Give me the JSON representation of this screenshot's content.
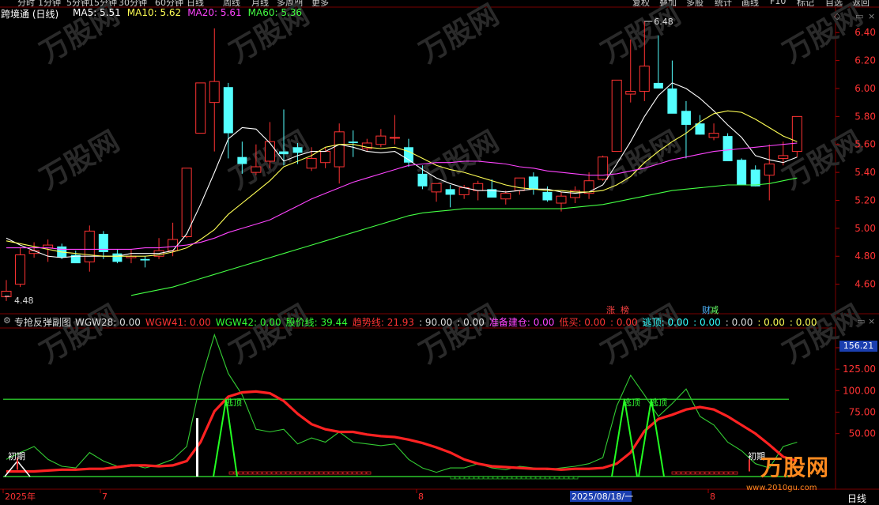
{
  "menu": {
    "left": [
      "分时",
      "1分钟",
      "5分钟",
      "15分钟",
      "30分钟",
      "60分钟",
      "日线",
      "周线",
      "月线",
      "多周期",
      "更多"
    ],
    "right": [
      "复权",
      "叠加",
      "多股",
      "统计",
      "画线",
      "F10",
      "标记",
      "自选",
      "返回"
    ]
  },
  "main_panel": {
    "title": "跨境通 (日线)",
    "ma_labels": [
      {
        "name": "MA5",
        "value": "5.51",
        "color": "#ffffff"
      },
      {
        "name": "MA10",
        "value": "5.62",
        "color": "#ffff55"
      },
      {
        "name": "MA20",
        "value": "5.61",
        "color": "#ff44ff"
      },
      {
        "name": "MA60",
        "value": "5.36",
        "color": "#44ff44"
      }
    ],
    "high_label": "6.48",
    "low_label": "4.48",
    "event_tags": [
      {
        "text": "涨",
        "color": "#ff4444"
      },
      {
        "text": "榜",
        "color": "#ff4444"
      },
      {
        "text": "财",
        "color": "#4fb6ff"
      },
      {
        "text": "减",
        "color": "#66ff66"
      }
    ]
  },
  "sub_panel": {
    "title": "专抢反弹副图",
    "items": [
      {
        "text": "WGW28: 0.00",
        "color": "#dddddd"
      },
      {
        "text": "WGW41: 0.00",
        "color": "#ff3333"
      },
      {
        "text": "WGW42: 0.00",
        "color": "#33ff33"
      },
      {
        "text": "股价线: 39.44",
        "color": "#33ff33"
      },
      {
        "text": "趋势线: 21.93",
        "color": "#ff3333"
      },
      {
        "text": ": 90.00",
        "color": "#dddddd"
      },
      {
        "text": ": 0.00",
        "color": "#dddddd"
      },
      {
        "text": "准备建仓: 0.00",
        "color": "#ff44ff"
      },
      {
        "text": "低买: 0.00",
        "color": "#ff3333"
      },
      {
        "text": ": 0.00",
        "color": "#ff3333"
      },
      {
        "text": "逃顶: 0.00",
        "color": "#33ffff"
      },
      {
        "text": ": 0.00",
        "color": "#33ffff"
      },
      {
        "text": ": 0.00",
        "color": "#dddddd"
      },
      {
        "text": ": 0.00",
        "color": "#ffff55"
      },
      {
        "text": ": 0.00",
        "color": "#ffff55"
      }
    ],
    "current_value": "156.21",
    "annotations": {
      "initial": "初期",
      "escape_top": "逃顶"
    }
  },
  "date_axis": {
    "labels": [
      "2025年",
      "7",
      "8",
      "2025/08/18/一",
      "8"
    ],
    "period": "日线"
  },
  "watermark": {
    "brand": "万股网",
    "url": "www.2010gu.com"
  },
  "chart_data": [
    {
      "type": "candlestick",
      "title": "跨境通 (日线)",
      "ylim": [
        4.4,
        6.52
      ],
      "y_ticks": [
        4.6,
        4.8,
        5.0,
        5.2,
        5.4,
        5.6,
        5.8,
        6.0,
        6.2,
        6.4
      ],
      "candles": [
        {
          "o": 4.51,
          "h": 4.63,
          "l": 4.48,
          "c": 4.55
        },
        {
          "o": 4.6,
          "h": 4.86,
          "l": 4.58,
          "c": 4.81
        },
        {
          "o": 4.82,
          "h": 4.9,
          "l": 4.79,
          "c": 4.84
        },
        {
          "o": 4.86,
          "h": 4.92,
          "l": 4.76,
          "c": 4.88
        },
        {
          "o": 4.87,
          "h": 4.89,
          "l": 4.78,
          "c": 4.79
        },
        {
          "o": 4.81,
          "h": 4.84,
          "l": 4.76,
          "c": 4.75
        },
        {
          "o": 4.76,
          "h": 5.02,
          "l": 4.69,
          "c": 4.98
        },
        {
          "o": 4.96,
          "h": 4.98,
          "l": 4.78,
          "c": 4.83
        },
        {
          "o": 4.82,
          "h": 4.85,
          "l": 4.75,
          "c": 4.76
        },
        {
          "o": 4.79,
          "h": 4.85,
          "l": 4.75,
          "c": 4.8
        },
        {
          "o": 4.78,
          "h": 4.8,
          "l": 4.72,
          "c": 4.77
        },
        {
          "o": 4.8,
          "h": 4.93,
          "l": 4.78,
          "c": 4.84
        },
        {
          "o": 4.84,
          "h": 5.04,
          "l": 4.8,
          "c": 4.92
        },
        {
          "o": 4.94,
          "h": 5.43,
          "l": 4.93,
          "c": 5.43
        },
        {
          "o": 5.68,
          "h": 6.04,
          "l": 5.68,
          "c": 6.04
        },
        {
          "o": 5.9,
          "h": 6.43,
          "l": 5.55,
          "c": 6.05
        },
        {
          "o": 6.01,
          "h": 6.04,
          "l": 5.5,
          "c": 5.68
        },
        {
          "o": 5.51,
          "h": 5.62,
          "l": 5.39,
          "c": 5.46
        },
        {
          "o": 5.4,
          "h": 5.6,
          "l": 5.38,
          "c": 5.44
        },
        {
          "o": 5.48,
          "h": 5.76,
          "l": 5.43,
          "c": 5.62
        },
        {
          "o": 5.55,
          "h": 5.85,
          "l": 5.45,
          "c": 5.53
        },
        {
          "o": 5.58,
          "h": 5.61,
          "l": 5.46,
          "c": 5.54
        },
        {
          "o": 5.43,
          "h": 5.58,
          "l": 5.41,
          "c": 5.5
        },
        {
          "o": 5.47,
          "h": 5.58,
          "l": 5.43,
          "c": 5.55
        },
        {
          "o": 5.44,
          "h": 5.75,
          "l": 5.32,
          "c": 5.69
        },
        {
          "o": 5.62,
          "h": 5.7,
          "l": 5.51,
          "c": 5.61
        },
        {
          "o": 5.57,
          "h": 5.64,
          "l": 5.55,
          "c": 5.61
        },
        {
          "o": 5.6,
          "h": 5.71,
          "l": 5.58,
          "c": 5.66
        },
        {
          "o": 5.65,
          "h": 5.81,
          "l": 5.6,
          "c": 5.65
        },
        {
          "o": 5.58,
          "h": 5.64,
          "l": 5.44,
          "c": 5.47
        },
        {
          "o": 5.39,
          "h": 5.45,
          "l": 5.28,
          "c": 5.3
        },
        {
          "o": 5.26,
          "h": 5.32,
          "l": 5.19,
          "c": 5.32
        },
        {
          "o": 5.28,
          "h": 5.31,
          "l": 5.15,
          "c": 5.24
        },
        {
          "o": 5.24,
          "h": 5.31,
          "l": 5.21,
          "c": 5.29
        },
        {
          "o": 5.27,
          "h": 5.34,
          "l": 5.2,
          "c": 5.32
        },
        {
          "o": 5.28,
          "h": 5.35,
          "l": 5.23,
          "c": 5.22
        },
        {
          "o": 5.21,
          "h": 5.27,
          "l": 5.17,
          "c": 5.25
        },
        {
          "o": 5.27,
          "h": 5.35,
          "l": 5.24,
          "c": 5.36
        },
        {
          "o": 5.37,
          "h": 5.4,
          "l": 5.24,
          "c": 5.28
        },
        {
          "o": 5.26,
          "h": 5.3,
          "l": 5.19,
          "c": 5.2
        },
        {
          "o": 5.18,
          "h": 5.26,
          "l": 5.12,
          "c": 5.23
        },
        {
          "o": 5.22,
          "h": 5.3,
          "l": 5.18,
          "c": 5.27
        },
        {
          "o": 5.25,
          "h": 5.4,
          "l": 5.21,
          "c": 5.34
        },
        {
          "o": 5.35,
          "h": 5.52,
          "l": 5.34,
          "c": 5.51
        },
        {
          "o": 5.55,
          "h": 6.06,
          "l": 5.55,
          "c": 6.06
        },
        {
          "o": 5.96,
          "h": 6.35,
          "l": 5.9,
          "c": 5.98
        },
        {
          "o": 5.98,
          "h": 6.48,
          "l": 5.91,
          "c": 6.16
        },
        {
          "o": 6.04,
          "h": 6.38,
          "l": 6.0,
          "c": 6.0
        },
        {
          "o": 6.0,
          "h": 6.2,
          "l": 5.85,
          "c": 5.82
        },
        {
          "o": 5.84,
          "h": 5.91,
          "l": 5.5,
          "c": 5.74
        },
        {
          "o": 5.75,
          "h": 5.81,
          "l": 5.67,
          "c": 5.67
        },
        {
          "o": 5.65,
          "h": 5.75,
          "l": 5.63,
          "c": 5.68
        },
        {
          "o": 5.66,
          "h": 5.68,
          "l": 5.48,
          "c": 5.48
        },
        {
          "o": 5.49,
          "h": 5.5,
          "l": 5.31,
          "c": 5.31
        },
        {
          "o": 5.42,
          "h": 5.45,
          "l": 5.3,
          "c": 5.3
        },
        {
          "o": 5.38,
          "h": 5.6,
          "l": 5.2,
          "c": 5.46
        },
        {
          "o": 5.5,
          "h": 5.62,
          "l": 5.45,
          "c": 5.52
        },
        {
          "o": 5.55,
          "h": 5.8,
          "l": 5.51,
          "c": 5.8
        }
      ],
      "series": [
        {
          "name": "MA5",
          "color": "#ffffff",
          "values": [
            4.93,
            4.88,
            4.84,
            4.8,
            4.79,
            4.8,
            4.8,
            4.8,
            4.8,
            4.82,
            4.82,
            4.82,
            4.84,
            4.96,
            5.17,
            5.4,
            5.64,
            5.72,
            5.71,
            5.61,
            5.48,
            5.52,
            5.55,
            5.55,
            5.6,
            5.58,
            5.55,
            5.54,
            5.55,
            5.49,
            5.42,
            5.36,
            5.32,
            5.29,
            5.27,
            5.27,
            5.26,
            5.27,
            5.28,
            5.28,
            5.26,
            5.25,
            5.26,
            5.31,
            5.46,
            5.62,
            5.8,
            5.95,
            6.04,
            6.0,
            5.93,
            5.84,
            5.74,
            5.65,
            5.52,
            5.49,
            5.47,
            5.51
          ]
        },
        {
          "name": "MA10",
          "color": "#ffff55",
          "values": [
            4.91,
            4.89,
            4.87,
            4.85,
            4.83,
            4.82,
            4.81,
            4.8,
            4.8,
            4.8,
            4.8,
            4.81,
            4.83,
            4.86,
            4.92,
            4.99,
            5.1,
            5.18,
            5.26,
            5.34,
            5.44,
            5.48,
            5.52,
            5.58,
            5.6,
            5.6,
            5.58,
            5.57,
            5.58,
            5.55,
            5.5,
            5.45,
            5.42,
            5.4,
            5.37,
            5.34,
            5.31,
            5.29,
            5.28,
            5.27,
            5.27,
            5.26,
            5.26,
            5.27,
            5.31,
            5.37,
            5.47,
            5.55,
            5.62,
            5.68,
            5.76,
            5.82,
            5.84,
            5.83,
            5.78,
            5.72,
            5.66,
            5.62
          ]
        },
        {
          "name": "MA20",
          "color": "#ff44ff",
          "values": [
            4.86,
            4.86,
            4.86,
            4.86,
            4.85,
            4.85,
            4.85,
            4.85,
            4.85,
            4.85,
            4.86,
            4.86,
            4.87,
            4.88,
            4.9,
            4.93,
            4.97,
            5.0,
            5.03,
            5.06,
            5.11,
            5.16,
            5.21,
            5.25,
            5.29,
            5.33,
            5.36,
            5.39,
            5.42,
            5.45,
            5.46,
            5.47,
            5.47,
            5.48,
            5.48,
            5.47,
            5.46,
            5.44,
            5.43,
            5.41,
            5.4,
            5.39,
            5.38,
            5.38,
            5.39,
            5.41,
            5.43,
            5.46,
            5.49,
            5.51,
            5.53,
            5.55,
            5.56,
            5.57,
            5.58,
            5.59,
            5.6,
            5.61
          ]
        },
        {
          "name": "MA60",
          "color": "#44ff44",
          "values": [
            null,
            null,
            null,
            null,
            null,
            null,
            null,
            null,
            null,
            4.52,
            4.54,
            4.56,
            4.58,
            4.61,
            4.64,
            4.67,
            4.7,
            4.73,
            4.76,
            4.79,
            4.82,
            4.85,
            4.88,
            4.91,
            4.94,
            4.97,
            5.0,
            5.03,
            5.06,
            5.09,
            5.11,
            5.12,
            5.13,
            5.14,
            5.14,
            5.14,
            5.14,
            5.14,
            5.14,
            5.14,
            5.14,
            5.15,
            5.16,
            5.17,
            5.19,
            5.21,
            5.23,
            5.25,
            5.27,
            5.28,
            5.29,
            5.3,
            5.31,
            5.31,
            5.31,
            5.32,
            5.34,
            5.36
          ]
        }
      ]
    },
    {
      "type": "line",
      "title": "专抢反弹副图",
      "ylim": [
        0,
        165
      ],
      "y_ticks": [
        50,
        75,
        100,
        125,
        150
      ],
      "reference_lines": [
        {
          "value": 90,
          "color": "#33ee33"
        },
        {
          "value": 0,
          "color": "#33ee33"
        }
      ],
      "series": [
        {
          "name": "趋势线",
          "color": "#ff2222",
          "values": [
            6,
            6,
            6,
            7,
            8,
            8,
            9,
            9,
            11,
            13,
            13,
            12,
            13,
            18,
            40,
            76,
            93,
            98,
            99,
            97,
            88,
            73,
            61,
            55,
            52,
            52,
            49,
            47,
            46,
            43,
            39,
            34,
            28,
            20,
            15,
            12,
            11,
            10,
            9,
            9,
            8,
            9,
            9,
            10,
            15,
            28,
            53,
            67,
            72,
            78,
            81,
            78,
            70,
            60,
            50,
            37,
            23,
            18
          ]
        },
        {
          "name": "股价线",
          "color": "#33cc33",
          "values": [
            20,
            28,
            35,
            20,
            12,
            10,
            28,
            18,
            12,
            14,
            10,
            14,
            20,
            35,
            110,
            165,
            120,
            95,
            55,
            52,
            55,
            38,
            45,
            40,
            52,
            40,
            38,
            36,
            38,
            20,
            10,
            5,
            10,
            10,
            15,
            10,
            8,
            12,
            10,
            8,
            10,
            12,
            15,
            22,
            82,
            118,
            95,
            70,
            85,
            102,
            70,
            60,
            40,
            30,
            15,
            10,
            35,
            40
          ]
        }
      ]
    }
  ]
}
